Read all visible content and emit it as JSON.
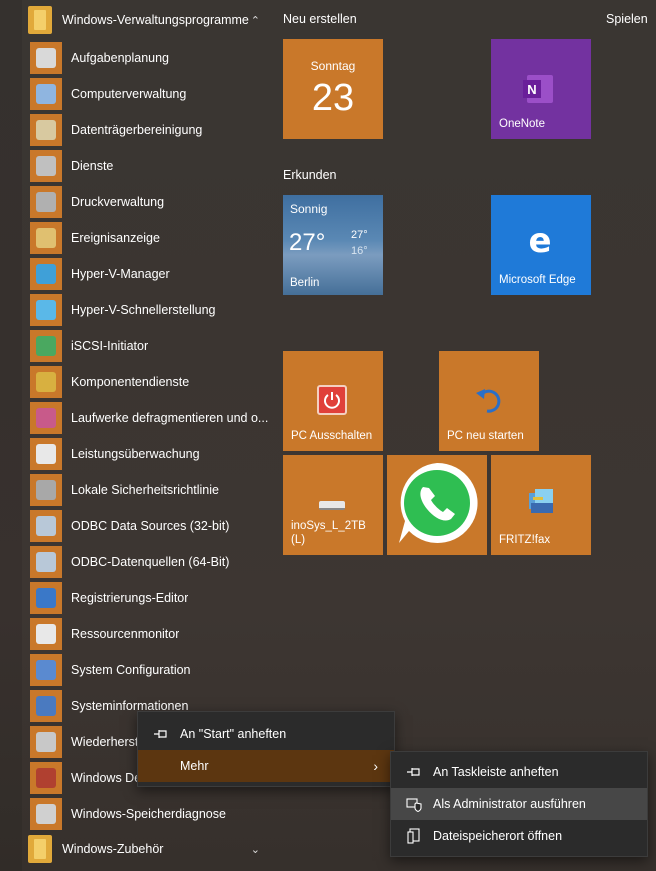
{
  "app_list": {
    "group_admin": {
      "label": "Windows-Verwaltungsprogramme",
      "chevron": "^"
    },
    "items": [
      {
        "label": "Aufgabenplanung",
        "icon": "clock-icon",
        "color": "#d9d9d9"
      },
      {
        "label": "Computerverwaltung",
        "icon": "computer-management-icon",
        "color": "#8fb5e0"
      },
      {
        "label": "Datenträgerbereinigung",
        "icon": "disk-cleanup-icon",
        "color": "#d8c9a0"
      },
      {
        "label": "Dienste",
        "icon": "gears-icon",
        "color": "#c0c0c0"
      },
      {
        "label": "Druckverwaltung",
        "icon": "printer-icon",
        "color": "#b0b0b0"
      },
      {
        "label": "Ereignisanzeige",
        "icon": "event-viewer-icon",
        "color": "#e0c070"
      },
      {
        "label": "Hyper-V-Manager",
        "icon": "hyperv-manager-icon",
        "color": "#3fa0d8"
      },
      {
        "label": "Hyper-V-Schnellerstellung",
        "icon": "hyperv-quick-icon",
        "color": "#5ab8e8"
      },
      {
        "label": "iSCSI-Initiator",
        "icon": "globe-icon",
        "color": "#4aa860"
      },
      {
        "label": "Komponentendienste",
        "icon": "component-services-icon",
        "color": "#d8b040"
      },
      {
        "label": "Laufwerke defragmentieren und o...",
        "icon": "defrag-icon",
        "color": "#c85a8a"
      },
      {
        "label": "Leistungsüberwachung",
        "icon": "performance-icon",
        "color": "#e8e8e8"
      },
      {
        "label": "Lokale Sicherheitsrichtlinie",
        "icon": "security-policy-icon",
        "color": "#a8a8a8"
      },
      {
        "label": "ODBC Data Sources (32-bit)",
        "icon": "odbc-icon",
        "color": "#b8c8d8"
      },
      {
        "label": "ODBC-Datenquellen (64-Bit)",
        "icon": "odbc-icon",
        "color": "#b8c8d8"
      },
      {
        "label": "Registrierungs-Editor",
        "icon": "registry-icon",
        "color": "#3a78c8"
      },
      {
        "label": "Ressourcenmonitor",
        "icon": "resource-monitor-icon",
        "color": "#e8e8e8"
      },
      {
        "label": "System Configuration",
        "icon": "system-config-icon",
        "color": "#5a8ad0"
      },
      {
        "label": "Systeminformationen",
        "icon": "system-info-icon",
        "color": "#4a7ac0"
      },
      {
        "label": "Wiederherstellung",
        "icon": "recovery-icon",
        "color": "#c8c8c8"
      },
      {
        "label": "Windows Defender Firewall",
        "icon": "firewall-icon",
        "color": "#b04030"
      },
      {
        "label": "Windows-Speicherdiagnose",
        "icon": "memory-diagnostic-icon",
        "color": "#d0d0d0"
      }
    ],
    "group_accessories": {
      "label": "Windows-Zubehör",
      "chevron": "v"
    }
  },
  "tiles": {
    "section_create": "Neu erstellen",
    "section_play": "Spielen",
    "section_explore": "Erkunden",
    "calendar": {
      "day": "Sonntag",
      "date": "23"
    },
    "onenote": {
      "label": "OneNote"
    },
    "weather": {
      "condition": "Sonnig",
      "temp": "27°",
      "high": "27°",
      "low": "16°",
      "city": "Berlin"
    },
    "edge": {
      "label": "Microsoft Edge"
    },
    "shutdown": {
      "label": "PC Ausschalten"
    },
    "restart": {
      "label": "PC neu starten"
    },
    "drive": {
      "label": "inoSys_L_2TB (L)"
    },
    "whatsapp": {
      "label": "WhatsApp"
    },
    "fritzfax": {
      "label": "FRITZ!fax"
    }
  },
  "context_menu": {
    "pin_start": "An \"Start\" anheften",
    "more": "Mehr"
  },
  "submenu": {
    "pin_taskbar": "An Taskleiste anheften",
    "run_as_admin": "Als Administrator ausführen",
    "open_location": "Dateispeicherort öffnen"
  },
  "colors": {
    "tile_orange": "#c9782a",
    "onenote_purple": "#7332a0",
    "edge_blue": "#1f7ad8",
    "weather_blue": "#4d79a4",
    "menu_highlight": "#5c3610"
  }
}
